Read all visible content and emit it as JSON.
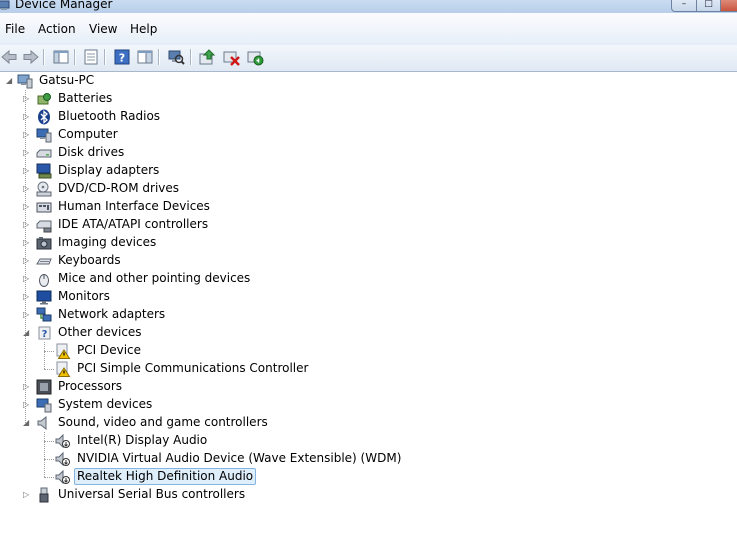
{
  "window": {
    "title": "Device Manager"
  },
  "menu": [
    "File",
    "Action",
    "View",
    "Help"
  ],
  "toolbar": [
    "back",
    "forward",
    "show-hide-console-tree",
    "properties",
    "help",
    "action-pane",
    "scan-for-hardware-changes",
    "update-driver",
    "uninstall",
    "enable"
  ],
  "tree": {
    "root": "Gatsu-PC",
    "categories": [
      {
        "label": "Batteries",
        "icon": "battery-icon"
      },
      {
        "label": "Bluetooth Radios",
        "icon": "bluetooth-icon"
      },
      {
        "label": "Computer",
        "icon": "computer-icon"
      },
      {
        "label": "Disk drives",
        "icon": "disk-drive-icon"
      },
      {
        "label": "Display adapters",
        "icon": "display-adapter-icon"
      },
      {
        "label": "DVD/CD-ROM drives",
        "icon": "dvd-drive-icon"
      },
      {
        "label": "Human Interface Devices",
        "icon": "hid-icon"
      },
      {
        "label": "IDE ATA/ATAPI controllers",
        "icon": "ide-controller-icon"
      },
      {
        "label": "Imaging devices",
        "icon": "camera-icon"
      },
      {
        "label": "Keyboards",
        "icon": "keyboard-icon"
      },
      {
        "label": "Mice and other pointing devices",
        "icon": "mouse-icon"
      },
      {
        "label": "Monitors",
        "icon": "monitor-icon"
      },
      {
        "label": "Network adapters",
        "icon": "network-icon"
      },
      {
        "label": "Other devices",
        "icon": "other-devices-icon",
        "expanded": true,
        "children": [
          "PCI Device",
          "PCI Simple Communications Controller"
        ]
      },
      {
        "label": "Processors",
        "icon": "processor-icon"
      },
      {
        "label": "System devices",
        "icon": "system-devices-icon"
      },
      {
        "label": "Sound, video and game controllers",
        "icon": "speaker-icon",
        "expanded": true,
        "children": [
          "Intel(R) Display Audio",
          "NVIDIA Virtual Audio Device (Wave Extensible) (WDM)",
          "Realtek High Definition Audio"
        ],
        "selected_child": "Realtek High Definition Audio"
      },
      {
        "label": "Universal Serial Bus controllers",
        "icon": "usb-icon"
      }
    ]
  },
  "colors": {
    "selection_bg": "#dfeefb",
    "selection_border": "#84b4e1",
    "warning": "#f2c200"
  }
}
